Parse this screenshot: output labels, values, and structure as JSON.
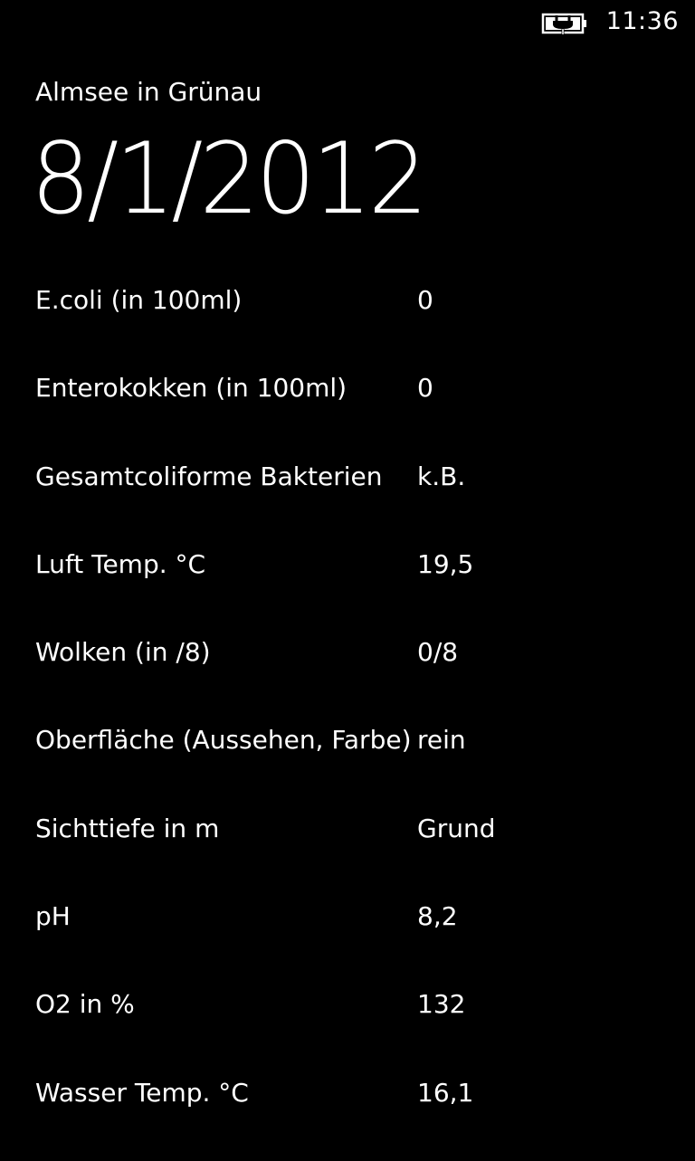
{
  "status_bar": {
    "time": "11:36",
    "battery_icon": "battery-charging-icon"
  },
  "header": {
    "subtitle": "Almsee in Grünau",
    "title": "8/1/2012"
  },
  "rows": [
    {
      "label": "E.coli (in 100ml)",
      "value": "0"
    },
    {
      "label": "Enterokokken (in 100ml)",
      "value": "0"
    },
    {
      "label": "Gesamtcoliforme Bakterien",
      "value": "k.B."
    },
    {
      "label": "Luft Temp. °C",
      "value": "19,5"
    },
    {
      "label": "Wolken (in /8)",
      "value": "0/8"
    },
    {
      "label": "Oberfläche (Aussehen, Farbe)",
      "value": "rein"
    },
    {
      "label": "Sichttiefe in m",
      "value": "Grund"
    },
    {
      "label": "pH",
      "value": "8,2"
    },
    {
      "label": "O2 in %",
      "value": "132"
    },
    {
      "label": "Wasser Temp. °C",
      "value": "16,1"
    }
  ]
}
